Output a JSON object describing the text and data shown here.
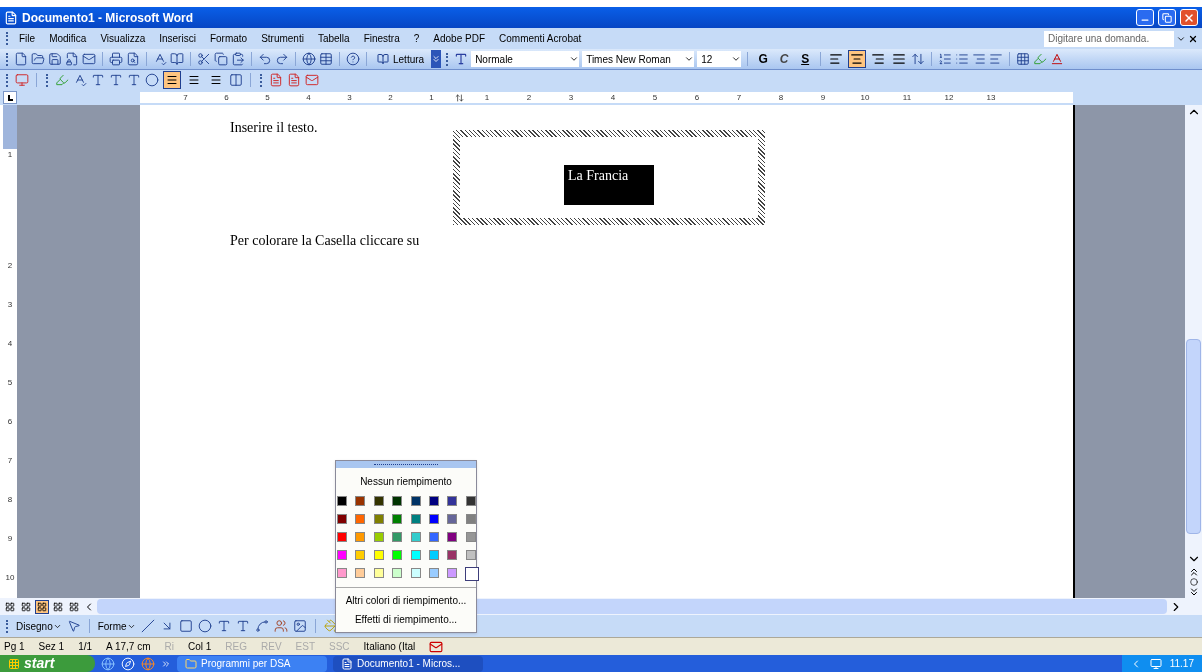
{
  "window": {
    "title": "Documento1 - Microsoft Word"
  },
  "menu": {
    "items": [
      "File",
      "Modifica",
      "Visualizza",
      "Inserisci",
      "Formato",
      "Strumenti",
      "Tabella",
      "Finestra",
      "?",
      "Adobe PDF",
      "Commenti Acrobat"
    ],
    "help_box": {
      "placeholder": "Digitare una domanda."
    }
  },
  "standard_toolbar": {
    "reading_button": "Lettura"
  },
  "format_toolbar": {
    "style": "Normale",
    "font": "Times New Roman",
    "size": "12",
    "bold": "G",
    "italic": "C",
    "underline": "S",
    "alignment": [
      {
        "selected": false
      },
      {
        "selected": true
      },
      {
        "selected": false
      },
      {
        "selected": false
      }
    ]
  },
  "third_toolbar": {
    "buttons": [
      {
        "selected": true
      },
      {
        "selected": false
      },
      {
        "selected": false
      }
    ]
  },
  "ruler": {
    "left_numbers": [
      "7",
      "6",
      "5",
      "4",
      "3",
      "2",
      "1"
    ],
    "right_numbers": [
      "1",
      "2",
      "3",
      "4",
      "5",
      "6",
      "7",
      "8",
      "9",
      "10",
      "11",
      "12",
      "13"
    ],
    "vertical_numbers": [
      "1",
      "2",
      "3",
      "4",
      "5",
      "6",
      "7",
      "8",
      "9",
      "10"
    ]
  },
  "document": {
    "paragraphs": [
      "Inserire il testo.",
      "Per colorare la Casella cliccare su"
    ],
    "text_box": {
      "text": "La Francia"
    }
  },
  "fill_menu": {
    "none_label": "Nessun riempimento",
    "colors": [
      {
        "color": "#000000",
        "selected": false
      },
      {
        "color": "#993300",
        "selected": false
      },
      {
        "color": "#333300",
        "selected": false
      },
      {
        "color": "#003300",
        "selected": false
      },
      {
        "color": "#003366",
        "selected": false
      },
      {
        "color": "#000080",
        "selected": false
      },
      {
        "color": "#333399",
        "selected": false
      },
      {
        "color": "#333333",
        "selected": false
      },
      {
        "color": "#800000",
        "selected": false
      },
      {
        "color": "#ff6600",
        "selected": false
      },
      {
        "color": "#808000",
        "selected": false
      },
      {
        "color": "#008000",
        "selected": false
      },
      {
        "color": "#008080",
        "selected": false
      },
      {
        "color": "#0000ff",
        "selected": false
      },
      {
        "color": "#666699",
        "selected": false
      },
      {
        "color": "#808080",
        "selected": false
      },
      {
        "color": "#ff0000",
        "selected": false
      },
      {
        "color": "#ff9900",
        "selected": false
      },
      {
        "color": "#99cc00",
        "selected": false
      },
      {
        "color": "#339966",
        "selected": false
      },
      {
        "color": "#33cccc",
        "selected": false
      },
      {
        "color": "#3366ff",
        "selected": false
      },
      {
        "color": "#800080",
        "selected": false
      },
      {
        "color": "#969696",
        "selected": false
      },
      {
        "color": "#ff00ff",
        "selected": false
      },
      {
        "color": "#ffcc00",
        "selected": false
      },
      {
        "color": "#ffff00",
        "selected": false
      },
      {
        "color": "#00ff00",
        "selected": false
      },
      {
        "color": "#00ffff",
        "selected": false
      },
      {
        "color": "#00ccff",
        "selected": false
      },
      {
        "color": "#993366",
        "selected": false
      },
      {
        "color": "#c0c0c0",
        "selected": false
      },
      {
        "color": "#ff99cc",
        "selected": false
      },
      {
        "color": "#ffcc99",
        "selected": false
      },
      {
        "color": "#ffff99",
        "selected": false
      },
      {
        "color": "#ccffcc",
        "selected": false
      },
      {
        "color": "#ccffff",
        "selected": false
      },
      {
        "color": "#99ccff",
        "selected": false
      },
      {
        "color": "#cc99ff",
        "selected": false
      },
      {
        "color": "#ffffff",
        "selected": true
      }
    ],
    "items": [
      "Altri colori di riempimento...",
      "Effetti di riempimento..."
    ]
  },
  "view_buttons": [
    {
      "selected": false
    },
    {
      "selected": false
    },
    {
      "selected": true
    },
    {
      "selected": false
    },
    {
      "selected": false
    }
  ],
  "drawing_toolbar": {
    "draw_menu": "Disegno",
    "shapes_menu": "Forme"
  },
  "status_bar": [
    {
      "text": "Pg 1",
      "disabled": false
    },
    {
      "text": "Sez 1",
      "disabled": false
    },
    {
      "text": "1/1",
      "disabled": false
    },
    {
      "text": "A 17,7 cm",
      "disabled": false
    },
    {
      "text": "Ri",
      "disabled": true
    },
    {
      "text": "Col 1",
      "disabled": false
    },
    {
      "text": "REG",
      "disabled": true
    },
    {
      "text": "REV",
      "disabled": true
    },
    {
      "text": "EST",
      "disabled": true
    },
    {
      "text": "SSC",
      "disabled": true
    },
    {
      "text": "Italiano (Ital",
      "disabled": false
    }
  ],
  "taskbar": {
    "start": "start",
    "tasks": [
      {
        "label": "Programmi per DSA",
        "selected": false
      },
      {
        "label": "Documento1 - Micros...",
        "selected": true
      }
    ],
    "clock": "11.17"
  }
}
